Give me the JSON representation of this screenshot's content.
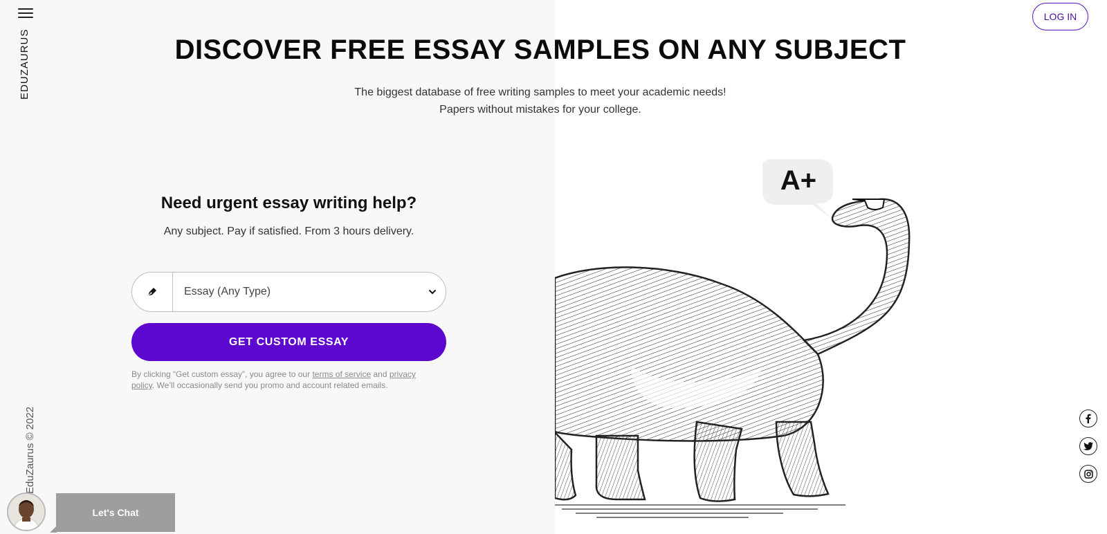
{
  "brand": "EDUZAURUS",
  "copyright": "EduZaurus © 2022",
  "header": {
    "login_label": "LOG IN"
  },
  "hero": {
    "title": "DISCOVER FREE ESSAY SAMPLES ON ANY SUBJECT",
    "subtitle_line1": "The biggest database of free writing samples to meet your academic needs!",
    "subtitle_line2": "Papers without mistakes for your college."
  },
  "form": {
    "title": "Need urgent essay writing help?",
    "subtitle": "Any subject. Pay if satisfied. From 3 hours delivery.",
    "select_value": "Essay (Any Type)",
    "cta_label": "GET CUSTOM ESSAY",
    "legal_prefix": "By clicking “Get custom essay”, you agree to our",
    "terms_link": "terms of service",
    "legal_and": "and",
    "privacy_link": "privacy policy",
    "legal_suffix": ". We’ll occasionally send you promo and account related emails."
  },
  "illustration": {
    "grade": "A+"
  },
  "social": {
    "icons": [
      "facebook-icon",
      "twitter-icon",
      "instagram-icon"
    ]
  },
  "chat": {
    "label": "Let's Chat"
  },
  "colors": {
    "accent": "#5c08cf",
    "left_bg": "#f8f8f8"
  }
}
